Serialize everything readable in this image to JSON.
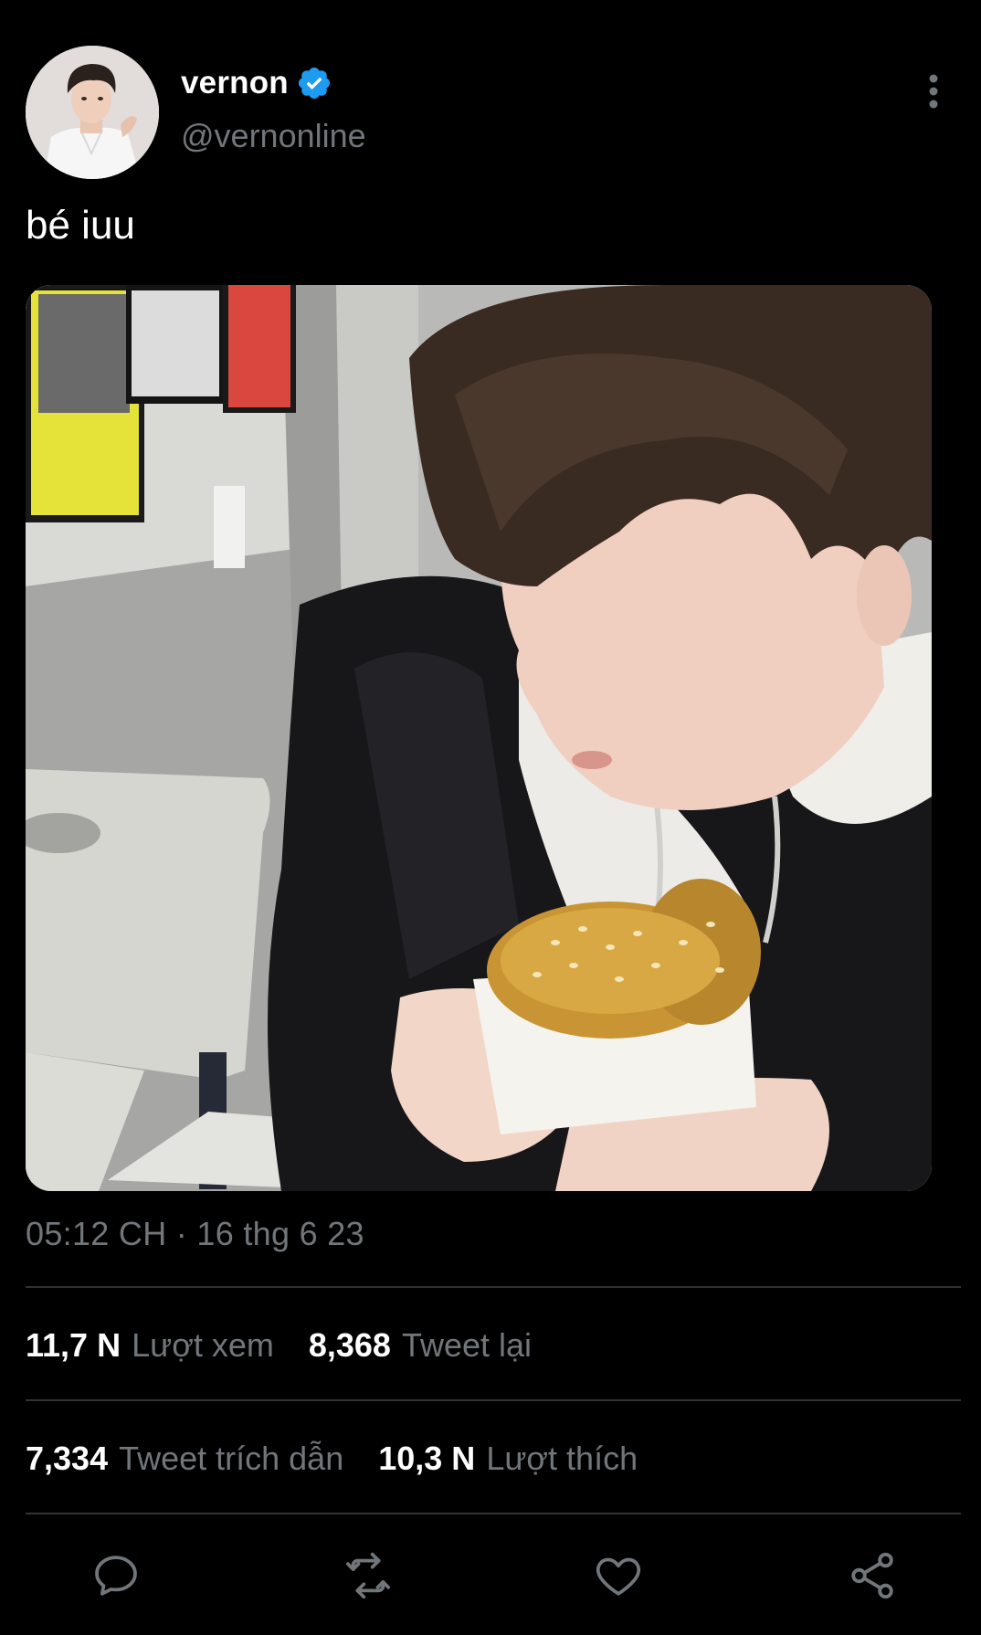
{
  "author": {
    "display_name": "vernon",
    "handle": "@vernonline",
    "verified": true,
    "verified_icon": "verified-badge-icon",
    "avatar": "profile-photo"
  },
  "tweet": {
    "text": "bé iuu",
    "media": "photo of person eating a sesame burger",
    "timestamp": "05:12 CH · 16 thg 6 23"
  },
  "stats": {
    "views_value": "11,7 N",
    "views_label": "Lượt xem",
    "retweets_value": "8,368",
    "retweets_label": "Tweet lại",
    "quotes_value": "7,334",
    "quotes_label": "Tweet trích dẫn",
    "likes_value": "10,3 N",
    "likes_label": "Lượt thích"
  },
  "actions": [
    "reply-icon",
    "retweet-icon",
    "like-icon",
    "share-icon"
  ],
  "colors": {
    "background": "#000000",
    "primary_text": "#ffffff",
    "secondary_text": "#71767b",
    "divider": "#2f3336",
    "verified": "#1d9bf0",
    "icon": "#71767b"
  }
}
